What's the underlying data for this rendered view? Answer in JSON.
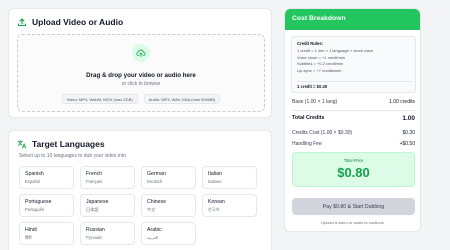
{
  "upload": {
    "title": "Upload Video or Audio",
    "drop_text": "Drag & drop your video or audio here",
    "browse_text": "or click to browse",
    "video_formats": "Video: MP4, WebM, MOV (max 2GB)",
    "audio_formats": "Audio: MP3, WAV, M4A (max 500MB)"
  },
  "languages": {
    "title": "Target Languages",
    "subtitle": "Select up to 10 languages to dub your video into",
    "items": [
      {
        "name": "Spanish",
        "native": "Español"
      },
      {
        "name": "French",
        "native": "Français"
      },
      {
        "name": "German",
        "native": "Deutsch"
      },
      {
        "name": "Italian",
        "native": "Italiano"
      },
      {
        "name": "Portuguese",
        "native": "Português"
      },
      {
        "name": "Japanese",
        "native": "日本語"
      },
      {
        "name": "Chinese",
        "native": "中文"
      },
      {
        "name": "Korean",
        "native": "한국어"
      },
      {
        "name": "Hindi",
        "native": "हिंदी"
      },
      {
        "name": "Russian",
        "native": "Русский"
      },
      {
        "name": "Arabic",
        "native": "العربية"
      }
    ]
  },
  "cost": {
    "title": "Cost Breakdown",
    "rules_title": "Credit Rules:",
    "rules": [
      "1 credit = 1 min × 1 language × stock voice",
      "Voice clone = +1 credit/min",
      "Subtitles = +0.2 credit/min",
      "Lip-sync = +7 credits/min"
    ],
    "rules_total": "1 credit = $0.30",
    "base_label": "Base (1.00 × 1 lang)",
    "base_value": "1.00 credits",
    "total_credits_label": "Total Credits",
    "total_credits_value": "1.00",
    "credits_cost_label": "Credits Cost (1.00 × $0.30)",
    "credits_cost_value": "$0.30",
    "handling_fee_label": "Handling Fee",
    "handling_fee_value": "+$0.50",
    "total_price_label": "Total Price",
    "total_price_value": "$0.80",
    "pay_button": "Pay $0.80 & Start Dubbing",
    "pay_note": "Upload a video or audio to continue"
  },
  "colors": {
    "accent": "#22c55e",
    "price_green": "#16a34a",
    "price_bg": "#dcfce7",
    "button_disabled": "#d1d5db"
  }
}
